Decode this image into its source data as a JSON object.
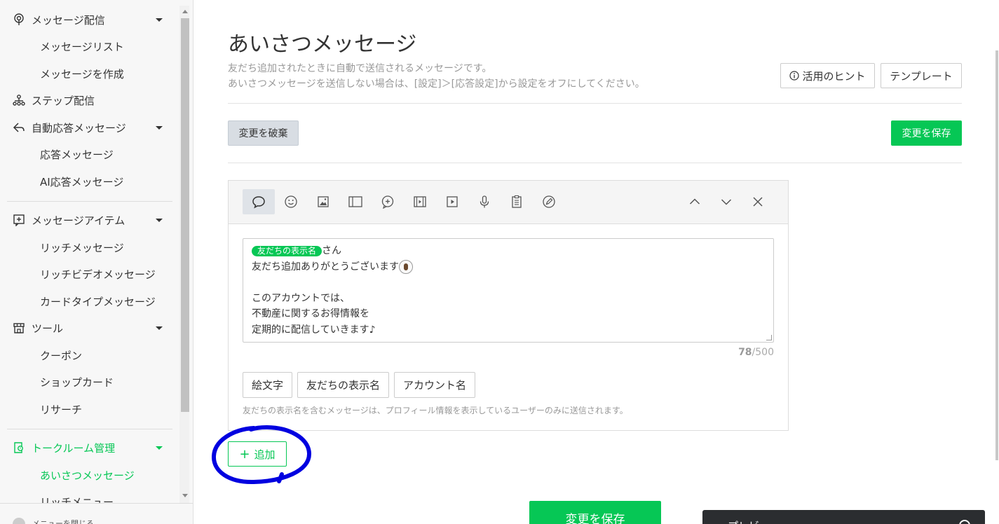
{
  "sidebar": {
    "items": [
      {
        "label": "メッセージ配信",
        "icon": "broadcast-icon"
      },
      {
        "label": "メッセージリスト"
      },
      {
        "label": "メッセージを作成"
      },
      {
        "label": "ステップ配信",
        "icon": "step-icon"
      },
      {
        "label": "自動応答メッセージ",
        "icon": "reply-icon"
      },
      {
        "label": "応答メッセージ"
      },
      {
        "label": "AI応答メッセージ"
      },
      {
        "label": "メッセージアイテム",
        "icon": "message-item-icon"
      },
      {
        "label": "リッチメッセージ"
      },
      {
        "label": "リッチビデオメッセージ"
      },
      {
        "label": "カードタイプメッセージ"
      },
      {
        "label": "ツール",
        "icon": "shop-icon"
      },
      {
        "label": "クーポン"
      },
      {
        "label": "ショップカード"
      },
      {
        "label": "リサーチ"
      },
      {
        "label": "トークルーム管理",
        "icon": "chatroom-icon"
      },
      {
        "label": "あいさつメッセージ"
      },
      {
        "label": "リッチメニュー"
      }
    ],
    "footer_label": "メニューを閉じる"
  },
  "header": {
    "title": "あいさつメッセージ",
    "description_line1": "友だち追加されたときに自動で送信されるメッセージです。",
    "description_line2": "あいさつメッセージを送信しない場合は、[設定]＞[応答設定]から設定をオフにしてください。",
    "hint_label": "活用のヒント",
    "template_label": "テンプレート"
  },
  "actions": {
    "discard_label": "変更を破棄",
    "save_label": "変更を保存"
  },
  "editor": {
    "tools": [
      "text-bubble-icon",
      "sticker-icon",
      "image-icon",
      "coupon-icon",
      "rich-message-icon",
      "rich-video-icon",
      "video-icon",
      "voice-icon",
      "survey-icon",
      "card-message-icon"
    ],
    "message": {
      "tag": "友だちの表示名",
      "line1_suffix": "さん",
      "line2": "友だち追加ありがとうございます",
      "line4": "このアカウントでは、",
      "line5": "不動産に関するお得情報を",
      "line6": "定期的に配信していきます♪"
    },
    "counter_current": "78",
    "counter_max": "/500",
    "insert_buttons": [
      "絵文字",
      "友だちの表示名",
      "アカウント名"
    ],
    "note": "友だちの表示名を含むメッセージは、プロフィール情報を表示しているユーザーのみに送信されます。"
  },
  "add_label": "追加",
  "bottom_save_label": "変更を保存",
  "preview_label": "プレビュー",
  "colors": {
    "accent": "#06c755",
    "annotation": "#0000e0"
  }
}
